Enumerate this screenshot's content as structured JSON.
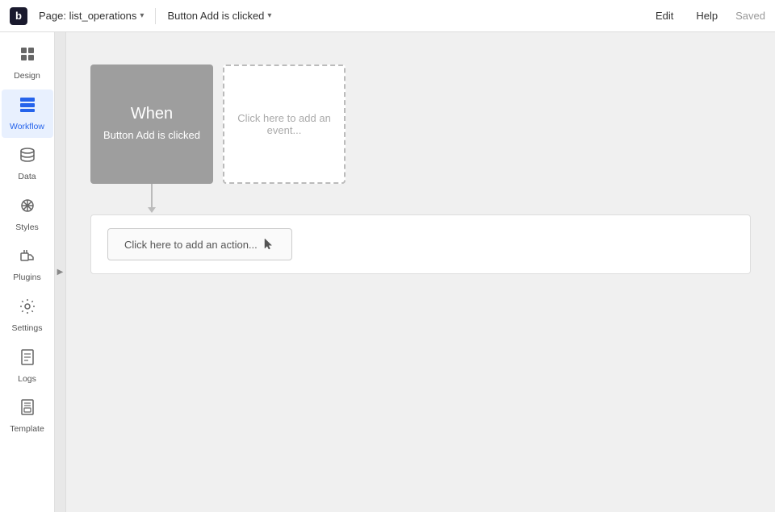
{
  "topbar": {
    "logo": "b",
    "page_label": "Page: list_operations",
    "page_chevron": "▾",
    "workflow_label": "Button Add is clicked",
    "workflow_chevron": "▾",
    "edit_label": "Edit",
    "help_label": "Help",
    "saved_label": "Saved"
  },
  "sidebar": {
    "items": [
      {
        "id": "design",
        "label": "Design",
        "icon": "✦",
        "active": false
      },
      {
        "id": "workflow",
        "label": "Workflow",
        "icon": "⊞",
        "active": true
      },
      {
        "id": "data",
        "label": "Data",
        "icon": "🗄",
        "active": false
      },
      {
        "id": "styles",
        "label": "Styles",
        "icon": "✏",
        "active": false
      },
      {
        "id": "plugins",
        "label": "Plugins",
        "icon": "🔌",
        "active": false
      },
      {
        "id": "settings",
        "label": "Settings",
        "icon": "⚙",
        "active": false
      },
      {
        "id": "logs",
        "label": "Logs",
        "icon": "📄",
        "active": false
      },
      {
        "id": "template",
        "label": "Template",
        "icon": "📋",
        "active": false
      }
    ]
  },
  "workflow": {
    "trigger_when": "When",
    "trigger_description": "Button Add is clicked",
    "add_event_text": "Click here to add an event...",
    "add_action_text": "Click here to add an action..."
  },
  "colors": {
    "trigger_bg": "#9e9e9e",
    "sidebar_active_bg": "#e8f0fe",
    "sidebar_active_color": "#2563eb"
  }
}
